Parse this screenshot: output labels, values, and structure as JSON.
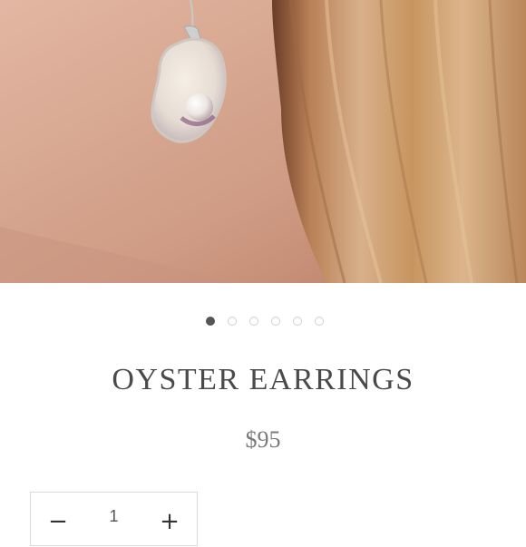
{
  "product": {
    "title": "OYSTER EARRINGS",
    "price": "$95"
  },
  "gallery": {
    "image_count": 6,
    "active_index": 0
  },
  "quantity": {
    "decrement_symbol": "−",
    "value": "1",
    "increment_symbol": "+"
  },
  "colors": {
    "text": "#4a4a4a",
    "price": "#7a7a7a",
    "active_dot": "#555555",
    "inactive_dot_border": "#cfcfcf",
    "border": "#d9d9d9"
  }
}
